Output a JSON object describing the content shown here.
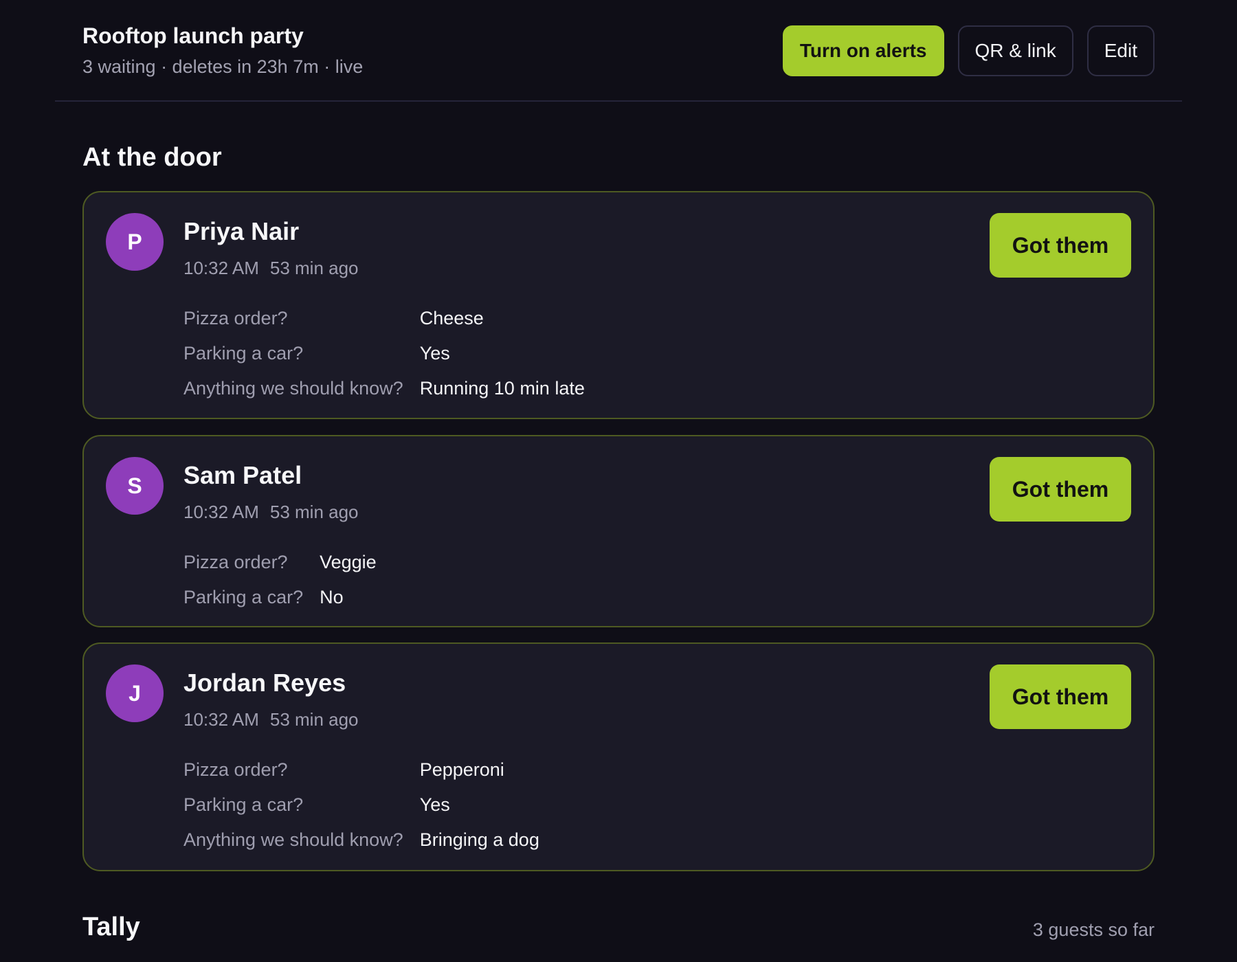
{
  "header": {
    "title": "Rooftop launch party",
    "meta": "3 waiting · deletes in 23h 7m · live",
    "alerts_label": "Turn on alerts",
    "qr_label": "QR & link",
    "edit_label": "Edit"
  },
  "colors": {
    "accent": "#a4cc2c",
    "avatar": "#8e3dba",
    "background": "#0f0e17",
    "card": "#1b1a27"
  },
  "door": {
    "title": "At the door",
    "guests": [
      {
        "initial": "P",
        "name": "Priya Nair",
        "time": "10:32 AM",
        "ago": "53 min ago",
        "action_label": "Got them",
        "answers": [
          {
            "q": "Pizza order?",
            "a": "Cheese"
          },
          {
            "q": "Parking a car?",
            "a": "Yes"
          },
          {
            "q": "Anything we should know?",
            "a": "Running 10 min late"
          }
        ]
      },
      {
        "initial": "S",
        "name": "Sam Patel",
        "time": "10:32 AM",
        "ago": "53 min ago",
        "action_label": "Got them",
        "answers": [
          {
            "q": "Pizza order?",
            "a": "Veggie"
          },
          {
            "q": "Parking a car?",
            "a": "No"
          }
        ]
      },
      {
        "initial": "J",
        "name": "Jordan Reyes",
        "time": "10:32 AM",
        "ago": "53 min ago",
        "action_label": "Got them",
        "answers": [
          {
            "q": "Pizza order?",
            "a": "Pepperoni"
          },
          {
            "q": "Parking a car?",
            "a": "Yes"
          },
          {
            "q": "Anything we should know?",
            "a": "Bringing a dog"
          }
        ]
      }
    ]
  },
  "tally": {
    "title": "Tally",
    "count": "3 guests so far"
  }
}
